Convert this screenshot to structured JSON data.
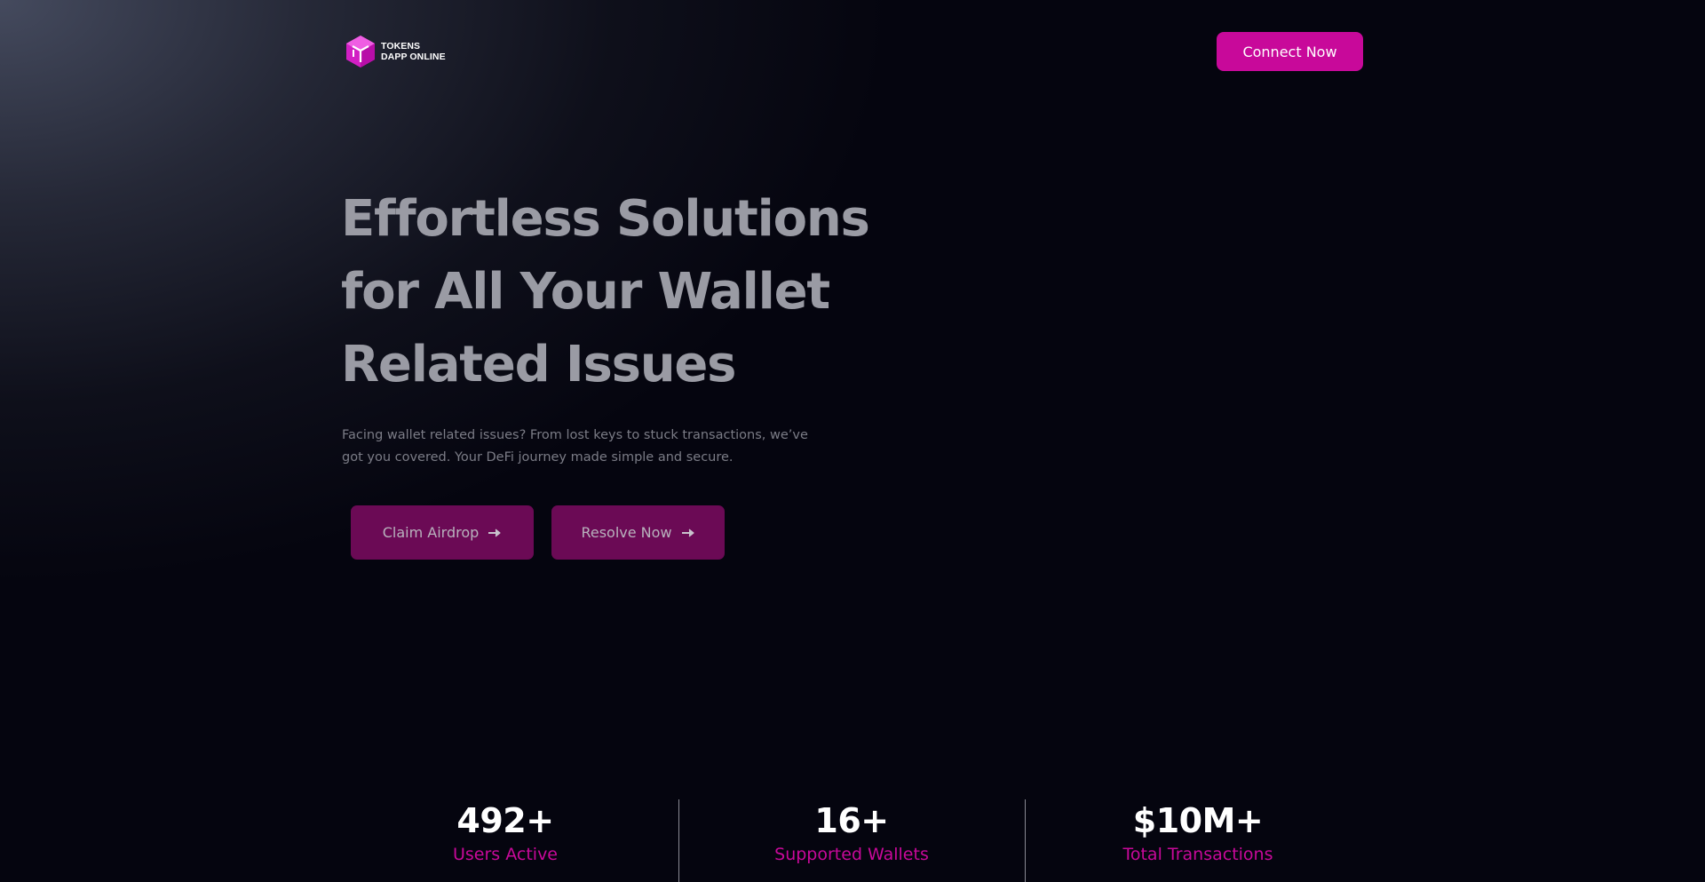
{
  "header": {
    "logo_line1": "TOKENS",
    "logo_line2": "DAPP ONLINE",
    "logo_icon": "cube-icon",
    "connect_label": "Connect Now"
  },
  "hero": {
    "title_lines": [
      "Effortless Solutions",
      "for All Your Wallet",
      "Related Issues"
    ],
    "description_line1": "Facing wallet related issues? From lost keys to stuck transactions, we’ve",
    "description_line2": "got you covered. Your DeFi journey made simple and secure.",
    "buttons": [
      {
        "label": "Claim Airdrop",
        "icon": "arrow-right-icon"
      },
      {
        "label": "Resolve Now",
        "icon": "arrow-right-icon"
      }
    ]
  },
  "stats": [
    {
      "value": "492+",
      "label": "Users Active"
    },
    {
      "value": "16+",
      "label": "Supported Wallets"
    },
    {
      "value": "$10M+",
      "label": "Total Transactions"
    }
  ],
  "colors": {
    "accent": "#c8099a",
    "cta_background": "#6b0a55",
    "page_background": "#05050f",
    "title_text": "#9a9ba4"
  }
}
